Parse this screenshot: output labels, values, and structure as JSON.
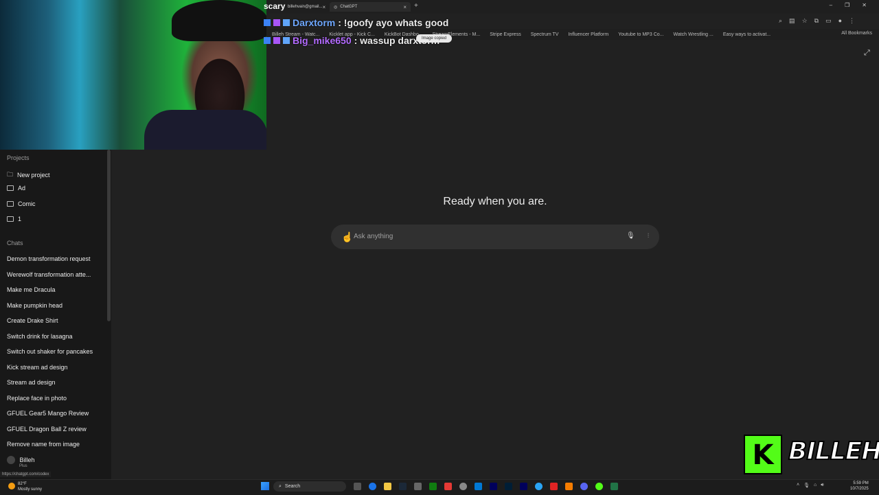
{
  "browser": {
    "tabs": [
      {
        "label": "billehvain@gmail...",
        "active": false
      },
      {
        "label": "ChatGPT",
        "active": true
      }
    ],
    "bookmarks": [
      "Billeh Stream - Watc...",
      "Kicklet app - Kick C...",
      "KickBot Dashbo...",
      "StreamElements - M...",
      "Stripe Express",
      "Spectrum TV",
      "Influencer Platform",
      "Youtube to MP3 Co...",
      "Watch Wrestling ...",
      "Easy ways to activat..."
    ],
    "all_bookmarks": "All Bookmarks"
  },
  "overlay": {
    "title": "scary",
    "chat": [
      {
        "user": "Darxtorm",
        "message": ": !goofy ayo whats good",
        "user_color": "#6fa8ff"
      },
      {
        "user": "Big_mike650",
        "message": ": wassup darxtorm",
        "user_color": "#b36bff"
      }
    ],
    "toast": "Image copied",
    "kick_letter": "K",
    "brand_text": "BILLEH"
  },
  "sidebar": {
    "projects_title": "Projects",
    "projects": [
      "New project",
      "Ad",
      "Comic",
      "1"
    ],
    "chats_title": "Chats",
    "chats": [
      "Demon transformation request",
      "Werewolf transformation atte...",
      "Make me Dracula",
      "Make pumpkin head",
      "Create Drake Shirt",
      "Switch drink for lasagna",
      "Switch out shaker for pancakes",
      "Kick stream ad design",
      "Stream ad design",
      "Replace face in photo",
      "GFUEL Gear5 Mango Review",
      "GFUEL Dragon Ball Z review",
      "Remove name from image"
    ],
    "profile_name": "Billeh",
    "profile_plan": "Plus",
    "status_url": "https://chatgpt.com/codex"
  },
  "main": {
    "heading": "Ready when you are.",
    "input_placeholder": "Ask anything"
  },
  "taskbar": {
    "weather_temp": "82°F",
    "weather_desc": "Mostly sunny",
    "search_label": "Search",
    "time": "5:59 PM",
    "date": "10/7/2025"
  },
  "colors": {
    "background": "#212121",
    "sidebar": "#181818",
    "input": "#303030",
    "kick_green": "#53fc18"
  }
}
